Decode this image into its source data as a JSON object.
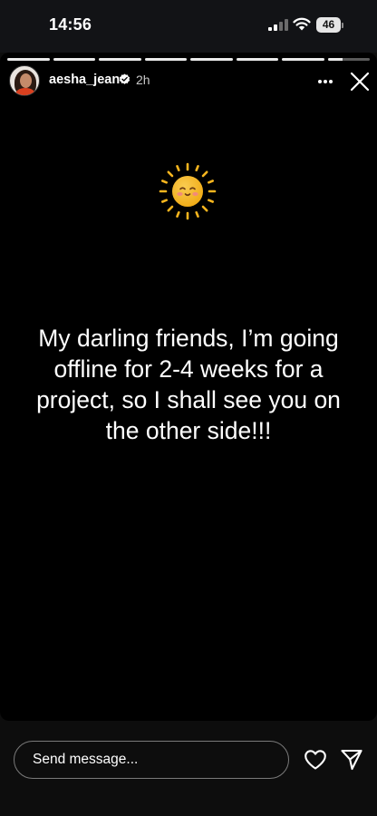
{
  "status_bar": {
    "time": "14:56",
    "battery_level": "46",
    "icons": [
      "signal-icon",
      "wifi-icon",
      "battery-icon"
    ]
  },
  "story": {
    "progress_segments_total": 8,
    "progress_current_fraction": 0.35,
    "username": "aesha_jean",
    "time_ago": "2h",
    "text": "My darling friends, I’m going offline for 2-4 weeks for a project, so I shall see you on the other side!!!",
    "sticker": "sun-emoji"
  },
  "reply_bar": {
    "placeholder": "Send message...",
    "icons": [
      "heart-icon",
      "send-icon"
    ]
  },
  "colors": {
    "background": "#000000",
    "chrome": "#0d0d0d",
    "text": "#ffffff",
    "sun": "#f6b51e"
  }
}
